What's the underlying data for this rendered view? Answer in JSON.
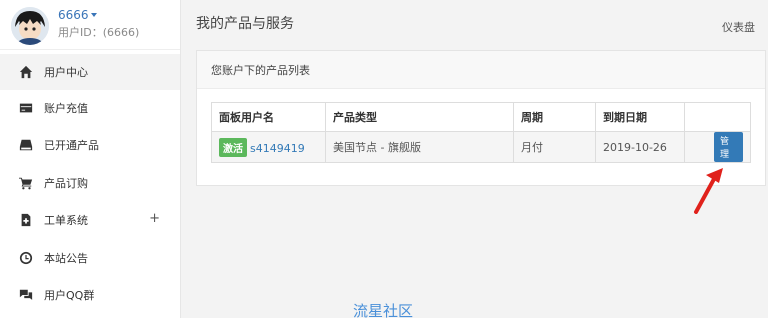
{
  "user": {
    "name": "6666",
    "id_line": "用户ID：(6666)"
  },
  "nav": [
    {
      "label": "用户中心",
      "icon": "home-icon"
    },
    {
      "label": "账户充值",
      "icon": "credit-card-icon"
    },
    {
      "label": "已开通产品",
      "icon": "hdd-icon"
    },
    {
      "label": "产品订购",
      "icon": "cart-icon"
    },
    {
      "label": "工单系统",
      "icon": "ticket-file-icon",
      "expand": "+"
    },
    {
      "label": "本站公告",
      "icon": "clock-icon"
    },
    {
      "label": "用户QQ群",
      "icon": "chat-icon"
    }
  ],
  "main": {
    "title": "我的产品与服务",
    "dashboard": "仪表盘",
    "panel_heading": "您账户下的产品列表",
    "table": {
      "headers": [
        "面板用户名",
        "产品类型",
        "周期",
        "到期日期",
        ""
      ],
      "rows": [
        {
          "badge": "激活",
          "username": "s4149419",
          "type": "美国节点 - 旗舰版",
          "cycle": "月付",
          "expiry": "2019-10-26",
          "action": "管理"
        }
      ]
    }
  },
  "watermark": "流星社区",
  "colors": {
    "link": "#337ab7",
    "badge_green": "#5cb85c",
    "arrow_red": "#e0211b"
  }
}
